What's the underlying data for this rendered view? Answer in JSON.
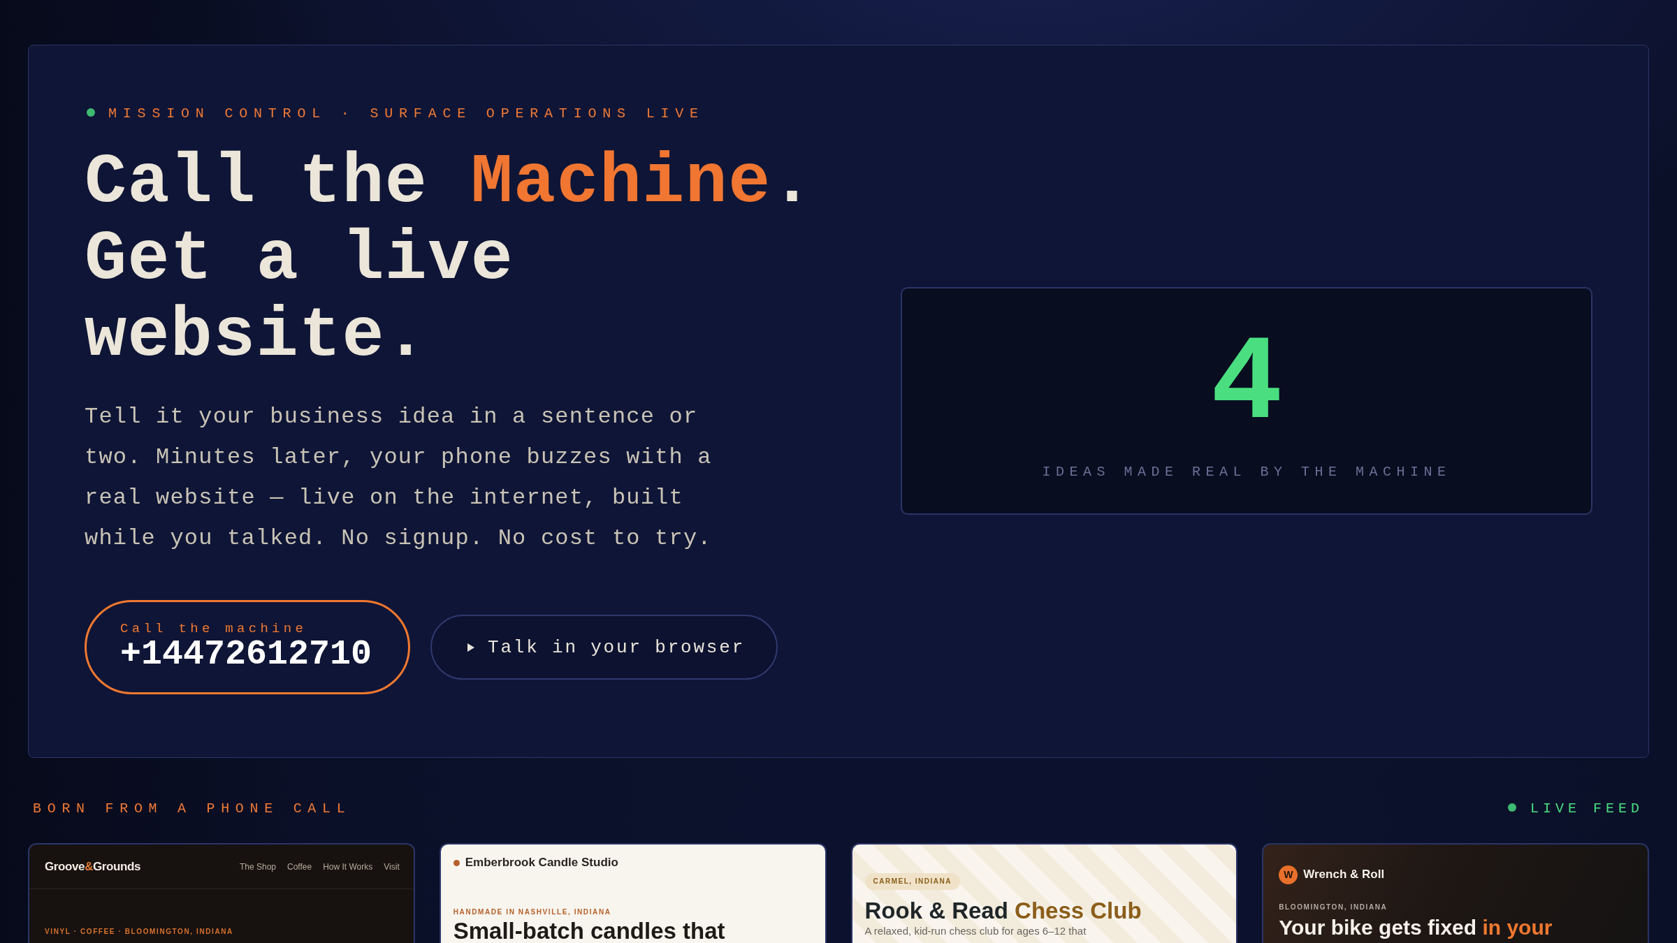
{
  "hero": {
    "kicker": "MISSION CONTROL · SURFACE OPERATIONS LIVE",
    "headline": [
      [
        {
          "text": "Call the ",
          "accent": false
        },
        {
          "text": "Machine",
          "accent": true
        },
        {
          "text": ".",
          "accent": false
        }
      ],
      [
        {
          "text": "Get a live website.",
          "accent": false
        }
      ]
    ],
    "description": "Tell it your business idea in a sentence or two. Minutes later, your phone buzzes with a real website — live on the internet, built while you talked. No signup. No cost to try.",
    "call_button": {
      "label": "Call the machine",
      "number": "+14472612710"
    },
    "browser_button": {
      "label": "Talk in your browser"
    },
    "stat": {
      "value": "4",
      "label": "IDEAS MADE REAL BY THE MACHINE"
    }
  },
  "feed": {
    "title": "BORN FROM A PHONE CALL",
    "live_label": "LIVE FEED",
    "cards": [
      {
        "kind": "storefront",
        "logo": [
          {
            "text": "Groove",
            "accent": false
          },
          {
            "text": "&",
            "accent": true
          },
          {
            "text": "Grounds",
            "accent": false
          }
        ],
        "nav": [
          "The Shop",
          "Coffee",
          "How It Works",
          "Visit"
        ],
        "eyebrow": "VINYL · COFFEE · BLOOMINGTON, INDIANA"
      },
      {
        "kind": "boutique",
        "brand": "Emberbrook Candle Studio",
        "eyebrow": "HANDMADE IN NASHVILLE, INDIANA",
        "heading": [
          {
            "text": "Small-batch candles that",
            "accent": false
          }
        ]
      },
      {
        "kind": "club",
        "tag": "CARMEL, INDIANA",
        "heading": [
          {
            "text": "Rook & Read ",
            "accent": false
          },
          {
            "text": "Chess Club",
            "accent": true
          }
        ],
        "description": "A relaxed, kid-run chess club for ages 6–12 that"
      },
      {
        "kind": "workshop",
        "monogram": "W",
        "brand": "Wrench & Roll",
        "eyebrow": "BLOOMINGTON, INDIANA",
        "heading": [
          {
            "text": "Your bike gets fixed ",
            "accent": false
          },
          {
            "text": "in your",
            "accent": true
          }
        ]
      }
    ]
  }
}
